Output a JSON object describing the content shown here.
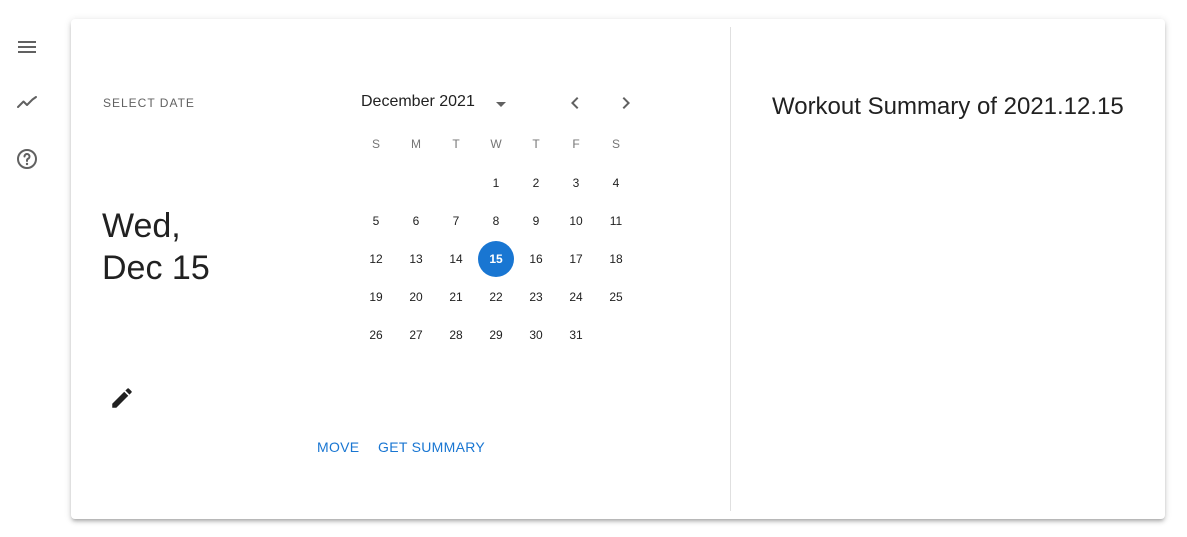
{
  "sidebar": {
    "items": [
      {
        "icon": "menu-icon"
      },
      {
        "icon": "trending-icon"
      },
      {
        "icon": "help-circle-icon"
      }
    ]
  },
  "picker": {
    "label": "SELECT DATE",
    "weekday_display": "Wed,",
    "date_display": "Dec 15",
    "month_year": "December 2021",
    "weekdays": [
      "S",
      "M",
      "T",
      "W",
      "T",
      "F",
      "S"
    ],
    "weeks": [
      [
        "",
        "",
        "",
        "1",
        "2",
        "3",
        "4"
      ],
      [
        "5",
        "6",
        "7",
        "8",
        "9",
        "10",
        "11"
      ],
      [
        "12",
        "13",
        "14",
        "15",
        "16",
        "17",
        "18"
      ],
      [
        "19",
        "20",
        "21",
        "22",
        "23",
        "24",
        "25"
      ],
      [
        "26",
        "27",
        "28",
        "29",
        "30",
        "31",
        ""
      ]
    ],
    "selected_day": "15",
    "accent_color": "#1976d2"
  },
  "actions": {
    "move_label": "MOVE",
    "summary_label": "GET SUMMARY"
  },
  "summary": {
    "title": "Workout Summary of 2021.12.15"
  }
}
